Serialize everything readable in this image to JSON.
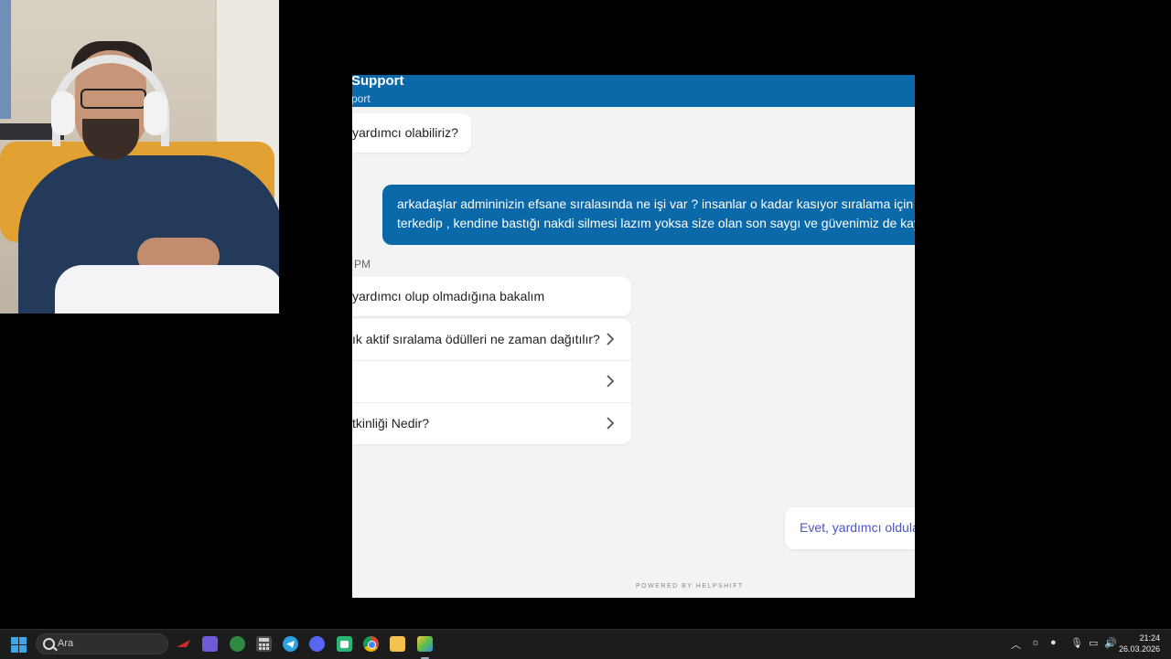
{
  "app": {
    "title": "Support",
    "subtitle": "port",
    "messages": {
      "bot_greeting": "yardımcı olabiliriz?",
      "user_line1": "arkadaşlar admininizin efsane sıralasında ne işi var ? insanlar o kadar kasıyor sıralama için a",
      "user_line2": "terkedip , kendine bastığı nakdi silmesi lazım yoksa size olan son saygı ve güvenimiz de kay",
      "timestamp": "PM",
      "bot_followup": "yardımcı olup olmadığına bakalım",
      "reply": "Evet, yardımcı oldula"
    },
    "faq": [
      {
        "label": "ık aktif sıralama ödülleri ne zaman dağıtılır?"
      },
      {
        "label": ""
      },
      {
        "label": "tkinliği Nedir?"
      }
    ],
    "powered_by": "POWERED BY HELPSHIFT"
  },
  "taskbar": {
    "search_placeholder": "Ara",
    "apps": [
      "lenovo-app",
      "tasks-app",
      "xbox-app",
      "calculator-app",
      "telegram-app",
      "discord-app",
      "android-app",
      "chrome-app",
      "file-explorer-app",
      "bluestacks-app"
    ],
    "tray": {
      "time": "21:24",
      "date": "26.03.2026"
    }
  },
  "colors": {
    "header": "#0b69a9",
    "user_bubble": "#0b69a9",
    "reply_text": "#4a56c4",
    "chat_bg": "#f2f3f5"
  }
}
